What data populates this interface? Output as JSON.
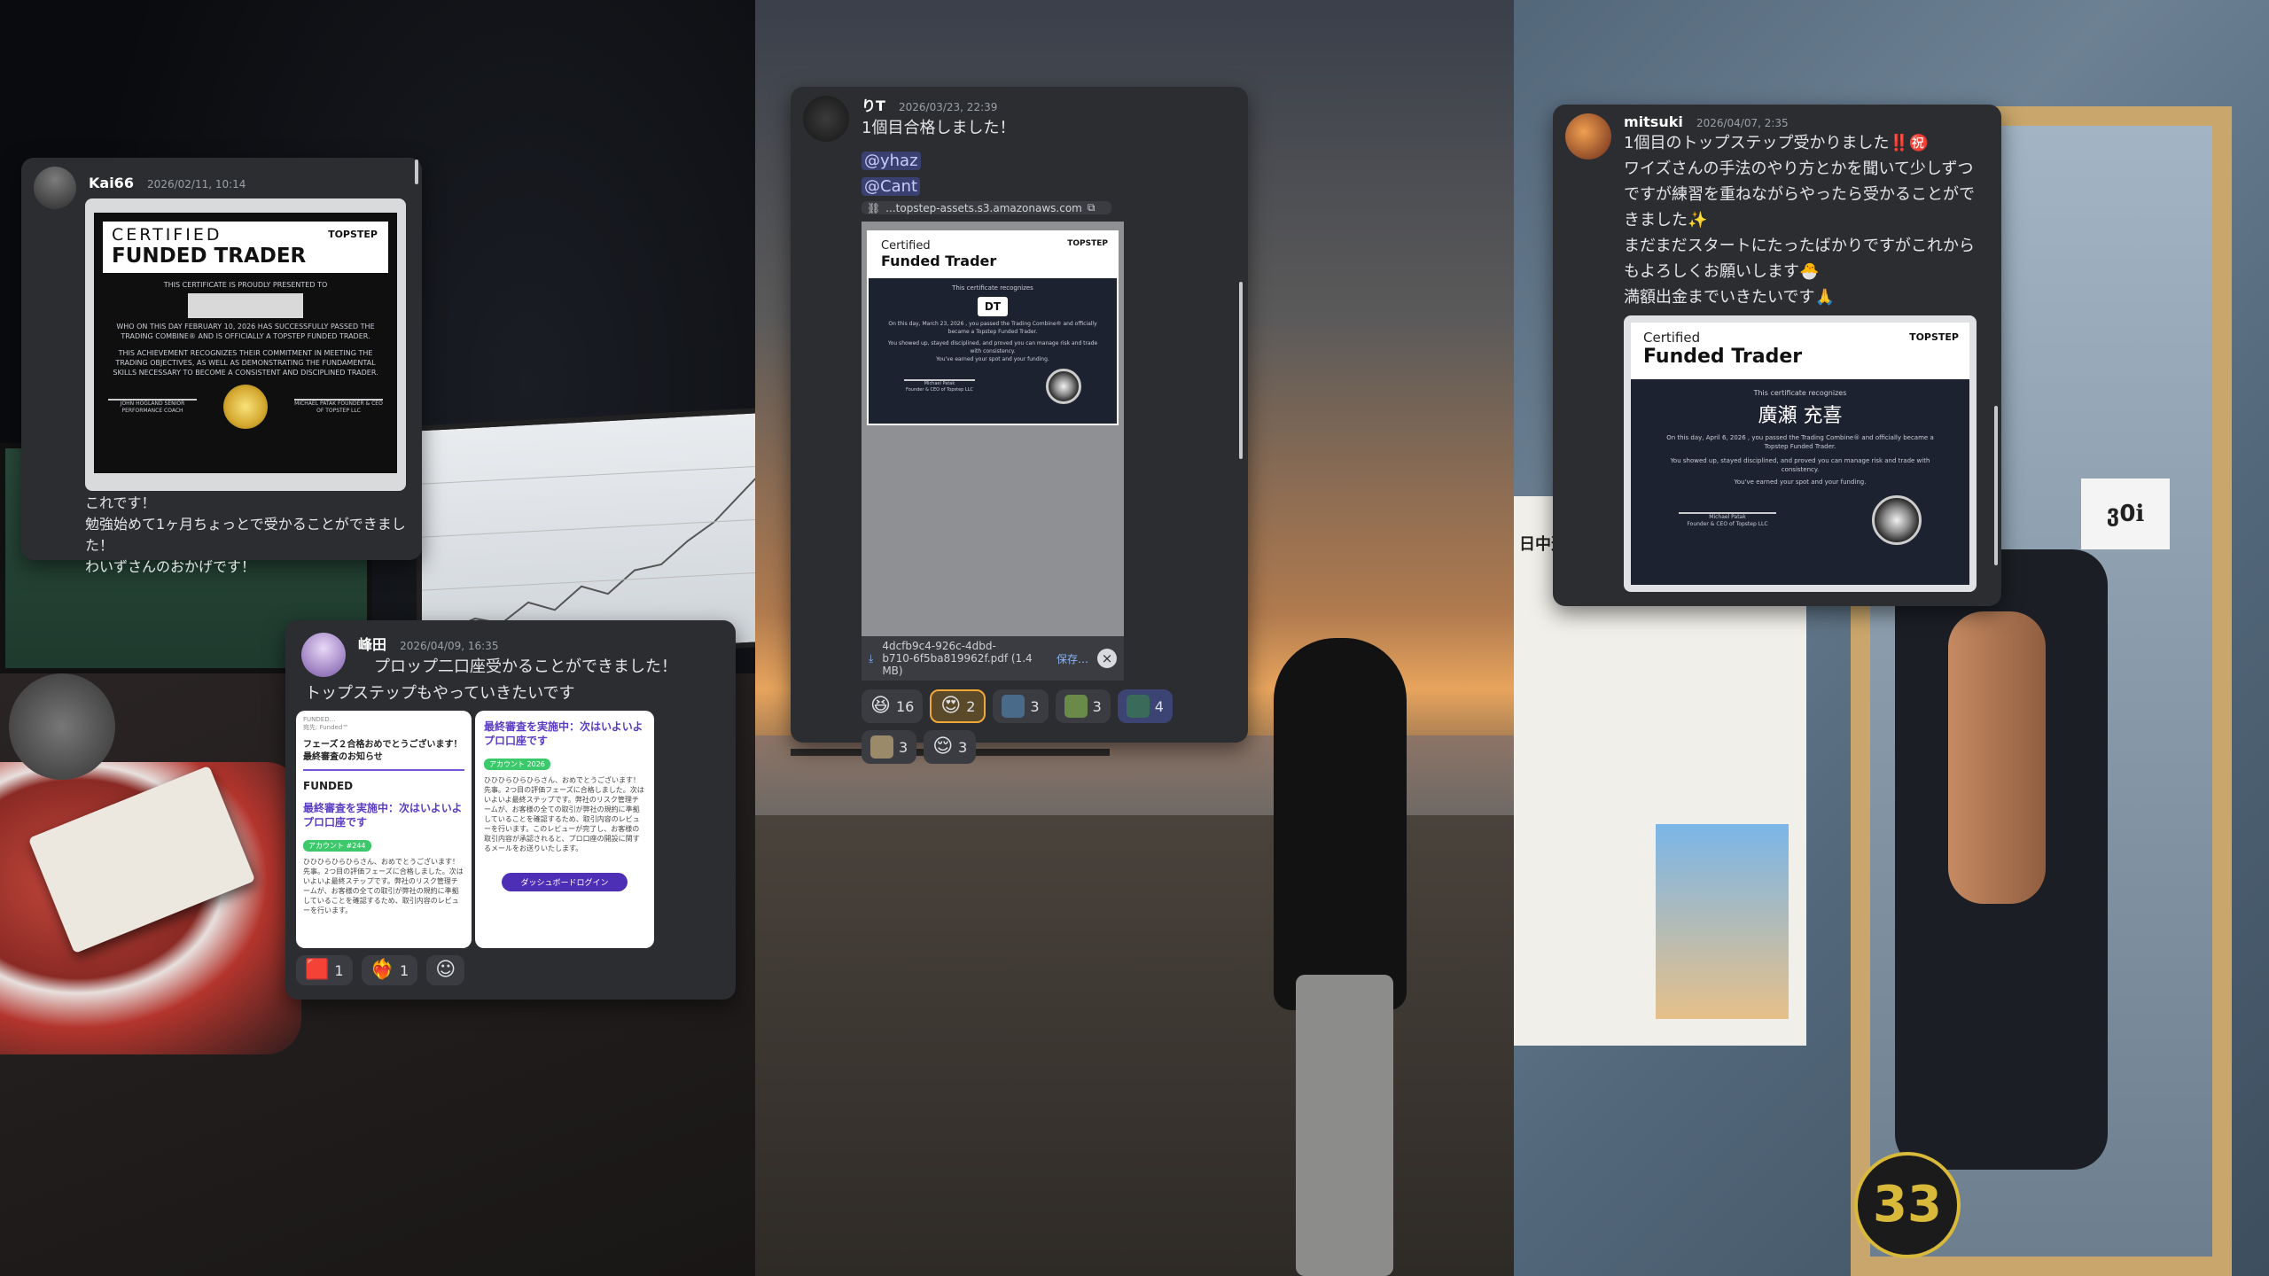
{
  "left": {
    "kai_card": {
      "username": "Kai66",
      "timestamp": "2026/02/11, 10:14",
      "cert": {
        "line1": "CERTIFIED",
        "line2": "FUNDED TRADER",
        "brand": "TOPSTEP",
        "presented": "THIS CERTIFICATE IS PROUDLY PRESENTED TO",
        "body": "WHO ON THIS DAY FEBRUARY 10, 2026 HAS SUCCESSFULLY PASSED THE TRADING COMBINE® AND IS OFFICIALLY A TOPSTEP FUNDED TRADER.",
        "body2": "THIS ACHIEVEMENT RECOGNIZES THEIR COMMITMENT IN MEETING THE TRADING OBJECTIVES, AS WELL AS DEMONSTRATING THE FUNDAMENTAL SKILLS NECESSARY TO BECOME A CONSISTENT AND DISCIPLINED TRADER.",
        "sig_left": "JOHN HOGLAND SENIOR PERFORMANCE COACH",
        "sig_right": "MICHAEL PATAK FOUNDER & CEO OF TOPSTEP LLC"
      },
      "lines": [
        "これです！",
        "勉強始めて1ヶ月ちょっとで受かることができまし",
        "た！",
        "わいずさんのおかげです！"
      ]
    },
    "mine_card": {
      "username": "峰田",
      "timestamp": "2026/04/09, 16:35",
      "lines": [
        "プロップ二口座受かることができました！",
        "トップステップもやっていきたいです"
      ],
      "shot_left": {
        "from": "FUNDED…",
        "to": "宛先: Funded™",
        "title": "フェーズ２合格おめでとうございます！最終審査のお知らせ",
        "logo": "FUNDED",
        "head": "最終審査を実施中：次はいよいよプロ口座です",
        "badge": "アカウント #244",
        "body": "ひひひらひらひらさん、おめでとうございます！先事。2つ目の評価フェーズに合格しました。次はいよいよ最終ステップです。弊社のリスク管理チームが、お客様の全ての取引が弊社の規約に準拠していることを確認するため、取引内容のレビューを行います。"
      },
      "shot_right": {
        "head": "最終審査を実施中：次はいよいよプロ口座です",
        "badge": "アカウント 2026",
        "body": "ひひひらひらひらさん、おめでとうございます！先事。2つ目の評価フェーズに合格しました。次はいよいよ最終ステップです。弊社のリスク管理チームが、お客様の全ての取引が弊社の規約に準拠していることを確認するため、取引内容のレビューを行います。このレビューが完了し、お客様の取引内容が承認されると、プロ口座の開設に関するメールをお送りいたします。",
        "button": "ダッシュボードログイン"
      },
      "reactions": [
        {
          "icon": "red-heart-square",
          "count": "1"
        },
        {
          "icon": "heart-on-fire",
          "count": "1"
        },
        {
          "icon": "add-reaction",
          "count": ""
        }
      ]
    }
  },
  "middle": {
    "card": {
      "username": "りT",
      "timestamp": "2026/03/23, 22:39",
      "line": "1個目合格しました！",
      "mentions": [
        "@yhaz",
        "@Cant"
      ],
      "link_preview": "...topstep-assets.s3.amazonaws.com",
      "cert": {
        "small": "Certified",
        "big": "Funded Trader",
        "brand": "TOPSTEP",
        "recognizes": "This certificate recognizes",
        "initials": "DT",
        "body": "On this day, March 23, 2026 , you passed the Trading Combine® and officially became a Topstep Funded Trader.",
        "body2": "You showed up, stayed disciplined, and proved you can manage risk and trade with consistency.",
        "body3": "You've earned your spot and your funding.",
        "signer": "Michael Patak",
        "signer_title": "Founder & CEO of Topstep LLC"
      },
      "file_name_1": "4dcfb9c4-926c-4dbd-",
      "file_name_2": "b710-6f5ba819962f.pdf (1.4 MB)",
      "save_label": "保存…",
      "reactions": [
        {
          "icon": "grinning-face",
          "count": "16"
        },
        {
          "icon": "heart-eyes-face",
          "count": "2"
        },
        {
          "icon": "avatar-reaction-1",
          "count": "3"
        },
        {
          "icon": "avatar-reaction-2",
          "count": "3"
        },
        {
          "icon": "avatar-reaction-3",
          "count": "4"
        },
        {
          "icon": "avatar-reaction-4",
          "count": "3"
        },
        {
          "icon": "relieved-face",
          "count": "3"
        }
      ]
    }
  },
  "right": {
    "card": {
      "username": "mitsuki",
      "timestamp": "2026/04/07, 2:35",
      "lines": [
        "1個目のトップステップ受かりました‼️㊗️",
        "ワイズさんの手法のやり方とかを聞いて少しずつ",
        "ですが練習を重ねながらやったら受かることがで",
        "きました✨",
        "まだまだスタートにたったばかりですがこれから",
        "もよろしくお願いします🐣",
        "満額出金までいきたいです🙏"
      ],
      "cert": {
        "small": "Certified",
        "big": "Funded Trader",
        "brand": "TOPSTEP",
        "recognizes": "This certificate recognizes",
        "name": "廣瀬 充喜",
        "body": "On this day, April 6, 2026 , you passed the Trading Combine® and officially became a Topstep Funded Trader.",
        "body2": "You showed up, stayed disciplined, and proved you can manage risk and trade with consistency.",
        "body3": "You've earned your spot and your funding.",
        "signer": "Michael Patak",
        "signer_title": "Founder & CEO of Topstep LLC"
      }
    },
    "poster_text": "日中週",
    "mirror_logo": "ვ0ℹ",
    "bottom_logo": "33"
  },
  "colors": {
    "card_bg": "#2b2d31",
    "mention": "#5865f2",
    "active_reaction": "#f0a838",
    "cert_dark": "#1c2230"
  }
}
